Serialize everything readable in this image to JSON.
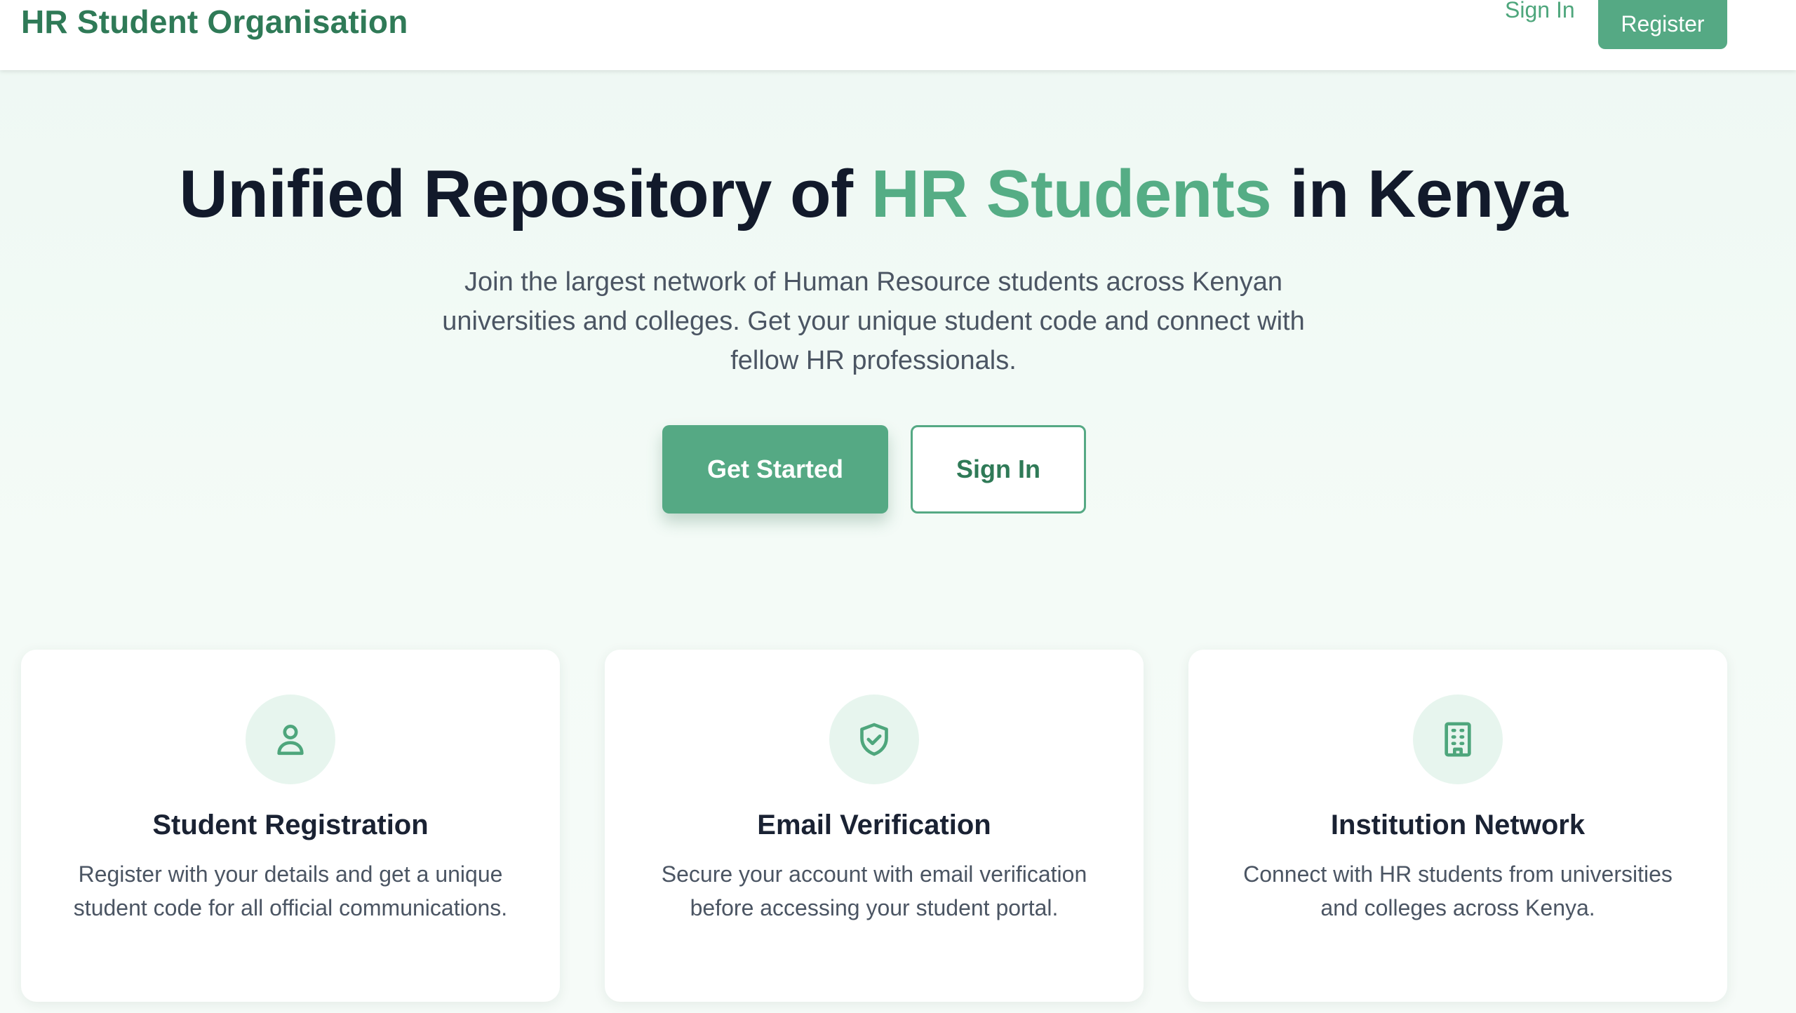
{
  "header": {
    "brand": "HR Student Organisation",
    "signin_label": "Sign In",
    "register_label": "Register"
  },
  "hero": {
    "title_part1": "Unified Repository of ",
    "title_accent": "HR Students",
    "title_part2": " in Kenya",
    "subtitle": "Join the largest network of Human Resource students across Kenyan universities and colleges. Get your unique student code and connect with fellow HR professionals.",
    "primary_button": "Get Started",
    "secondary_button": "Sign In"
  },
  "features": [
    {
      "icon": "user-icon",
      "title": "Student Registration",
      "text": "Register with your details and get a unique student code for all official communications."
    },
    {
      "icon": "shield-check-icon",
      "title": "Email Verification",
      "text": "Secure your account with email verification before accessing your student portal."
    },
    {
      "icon": "building-icon",
      "title": "Institution Network",
      "text": "Connect with HR students from universities and colleges across Kenya."
    }
  ],
  "colors": {
    "brand_green": "#2f7a57",
    "accent_green": "#55a984",
    "title_dark": "#121a2b",
    "body_gray": "#4b5563",
    "icon_bg": "#e7f5ee"
  }
}
